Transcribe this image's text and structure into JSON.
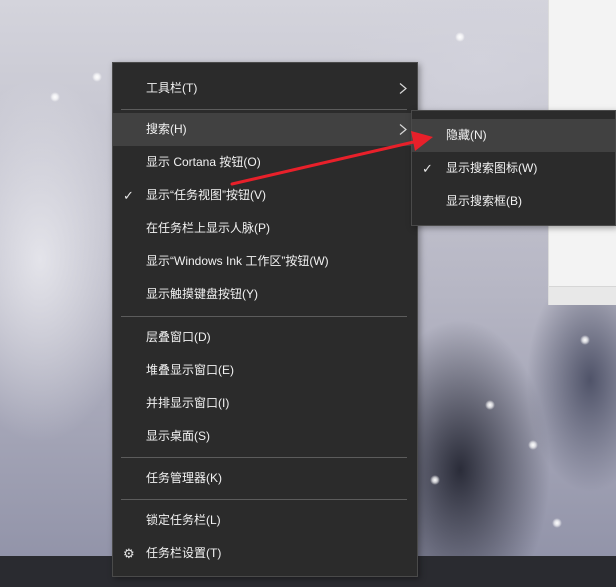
{
  "colors": {
    "menu_bg": "#2b2b2b",
    "menu_hover": "#414141",
    "menu_text": "#f2f2f2",
    "annotation_arrow": "#e8202a"
  },
  "taskbar_menu": {
    "items": [
      {
        "label": "工具栏(T)",
        "has_submenu": true
      },
      {
        "label": "搜索(H)",
        "has_submenu": true,
        "highlighted": true
      },
      {
        "label": "显示 Cortana 按钮(O)"
      },
      {
        "label": "显示“任务视图”按钮(V)",
        "checked": true
      },
      {
        "label": "在任务栏上显示人脉(P)"
      },
      {
        "label": "显示“Windows Ink 工作区”按钮(W)"
      },
      {
        "label": "显示触摸键盘按钮(Y)"
      },
      {
        "label": "层叠窗口(D)"
      },
      {
        "label": "堆叠显示窗口(E)"
      },
      {
        "label": "并排显示窗口(I)"
      },
      {
        "label": "显示桌面(S)"
      },
      {
        "label": "任务管理器(K)"
      },
      {
        "label": "锁定任务栏(L)"
      },
      {
        "label": "任务栏设置(T)",
        "icon": "gear-icon"
      }
    ]
  },
  "search_submenu": {
    "items": [
      {
        "label": "隐藏(N)",
        "highlighted": true
      },
      {
        "label": "显示搜索图标(W)",
        "checked": true
      },
      {
        "label": "显示搜索框(B)"
      }
    ]
  },
  "icons": {
    "check": "✓",
    "gear": "⚙",
    "submenu_chevron": "chevron-right-icon"
  }
}
